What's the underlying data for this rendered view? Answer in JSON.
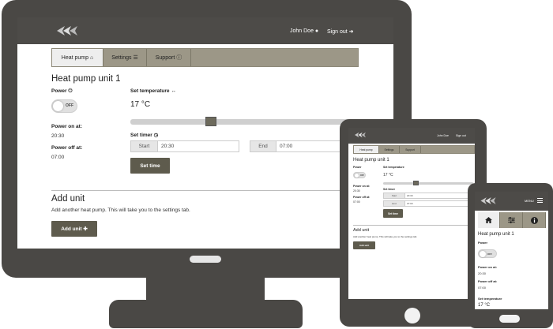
{
  "app": {
    "user_name": "John Doe",
    "sign_out": "Sign out",
    "menu": "MENU"
  },
  "tabs": [
    {
      "label": "Heat pump",
      "icon": "home-icon",
      "active": true
    },
    {
      "label": "Settings",
      "icon": "sliders-icon",
      "active": false
    },
    {
      "label": "Support",
      "icon": "info-icon",
      "active": false
    }
  ],
  "unit": {
    "title": "Heat pump unit 1",
    "power_label": "Power",
    "power_state": "OFF",
    "power_on_label": "Power on at:",
    "power_on_value": "20:30",
    "power_off_label": "Power off at:",
    "power_off_value": "07:00",
    "power_off_value_mobile": "07:00",
    "set_temperature_label": "Set temperature",
    "temperature_value": "17 °C",
    "slider_level": 0.33,
    "set_timer_label": "Set timer",
    "start_label": "Start",
    "start_value": "20:30",
    "end_label": "End",
    "end_value": "07:00",
    "set_time_button": "Set time"
  },
  "add_unit": {
    "title": "Add unit",
    "description": "Add another heat pump. This will take you to the settings tab.",
    "button": "Add unit"
  },
  "colors": {
    "device_frame": "#4a4845",
    "header_bar": "#4d4b48",
    "tab_bar": "#9c9787",
    "button": "#5e5b4d"
  }
}
